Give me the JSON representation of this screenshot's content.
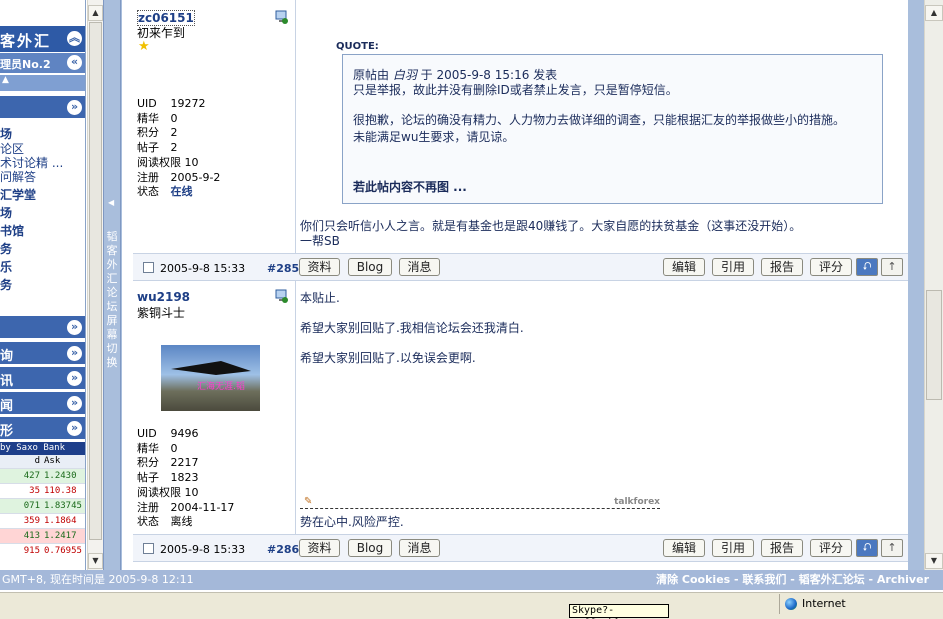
{
  "sidebar": {
    "headers": [
      {
        "text": "客外汇"
      },
      {
        "text": "理员No.2"
      }
    ],
    "links": [
      "场",
      "论区",
      "术讨论精 ...",
      "问解答",
      "汇学堂",
      "场",
      "书馆",
      "务",
      "乐",
      "务"
    ],
    "sections": [
      "询",
      "讯",
      "闻",
      "形"
    ],
    "ticker": {
      "caption": "by Saxo Bank",
      "columns": [
        "d",
        "Ask"
      ],
      "rows": [
        {
          "bid": "427",
          "ask": "1.2430",
          "color": "#dff3df"
        },
        {
          "bid": "35",
          "ask": "110.38",
          "color": "#ffffff"
        },
        {
          "bid": "071",
          "ask": "1.83745",
          "color": "#dff3df"
        },
        {
          "bid": "359",
          "ask": "1.1864",
          "color": "#ffffff"
        },
        {
          "bid": "413",
          "ask": "1.2417",
          "color": "#ffd5d5"
        },
        {
          "bid": "915",
          "ask": "0.76955",
          "color": "#ffffff"
        }
      ]
    }
  },
  "splitter": {
    "text": "韬客外汇论坛屏幕切换"
  },
  "posts": [
    {
      "username": "zc06151",
      "title": "初来乍到",
      "stats": [
        {
          "k": "UID",
          "v": "19272"
        },
        {
          "k": "精华",
          "v": "0"
        },
        {
          "k": "积分",
          "v": "2"
        },
        {
          "k": "帖子",
          "v": "2"
        },
        {
          "k": "阅读权限",
          "v": "10"
        },
        {
          "k": "注册",
          "v": "2005-9-2"
        },
        {
          "k": "状态",
          "v": "在线"
        }
      ],
      "quote": {
        "label": "QUOTE:",
        "line1_prefix": "原帖由 ",
        "line1_author": "白羽",
        "line1_suffix": " 于 2005-9-8 15:16 发表",
        "line2": "只是举报，故此并没有删除ID或者禁止发言，只是暂停短信。",
        "line3": "很抱歉，论坛的确没有精力、人力物力去做详细的调查，只能根据汇友的举报做些小的措施。",
        "line4": "未能满足wu生要求，请见谅。",
        "line5": "若此帖内容不再图 ..."
      },
      "body": [
        "你们只会听信小人之言。就是有基金也是跟40赚钱了。大家自愿的扶贫基金（这事还没开始）。",
        "一帮SB"
      ],
      "date": "2005-9-8 15:33",
      "number": "#285"
    },
    {
      "username": "wu2198",
      "title": "紫铜斗士",
      "avatar_caption": "汇海无涯.韬",
      "stats": [
        {
          "k": "UID",
          "v": "9496"
        },
        {
          "k": "精华",
          "v": "0"
        },
        {
          "k": "积分",
          "v": "2217"
        },
        {
          "k": "帖子",
          "v": "1823"
        },
        {
          "k": "阅读权限",
          "v": "10"
        },
        {
          "k": "注册",
          "v": "2004-11-17"
        },
        {
          "k": "状态",
          "v": "离线"
        }
      ],
      "body": [
        "本贴止.",
        "希望大家别回贴了.我相信论坛会还我清白.",
        "希望大家别回贴了.以免误会更啊."
      ],
      "sig_brand": "talkforex",
      "signature": "势在心中.风险严控.",
      "date": "2005-9-8 15:33",
      "number": "#286"
    }
  ],
  "buttons": {
    "profile": "资料",
    "blog": "Blog",
    "message": "消息",
    "edit": "编辑",
    "quote": "引用",
    "report": "报告",
    "rate": "评分"
  },
  "footer": {
    "left": "GMT+8, 现在时间是 2005-9-8 12:11",
    "right": "清除 Cookies - 联系我们 - 韬客外汇论坛 - Archiver"
  },
  "status": {
    "tooltip": "Skype?- coffeekl",
    "zone": "Internet"
  },
  "colors": {
    "accent": "#3a63a8",
    "link": "#1e3f86"
  }
}
